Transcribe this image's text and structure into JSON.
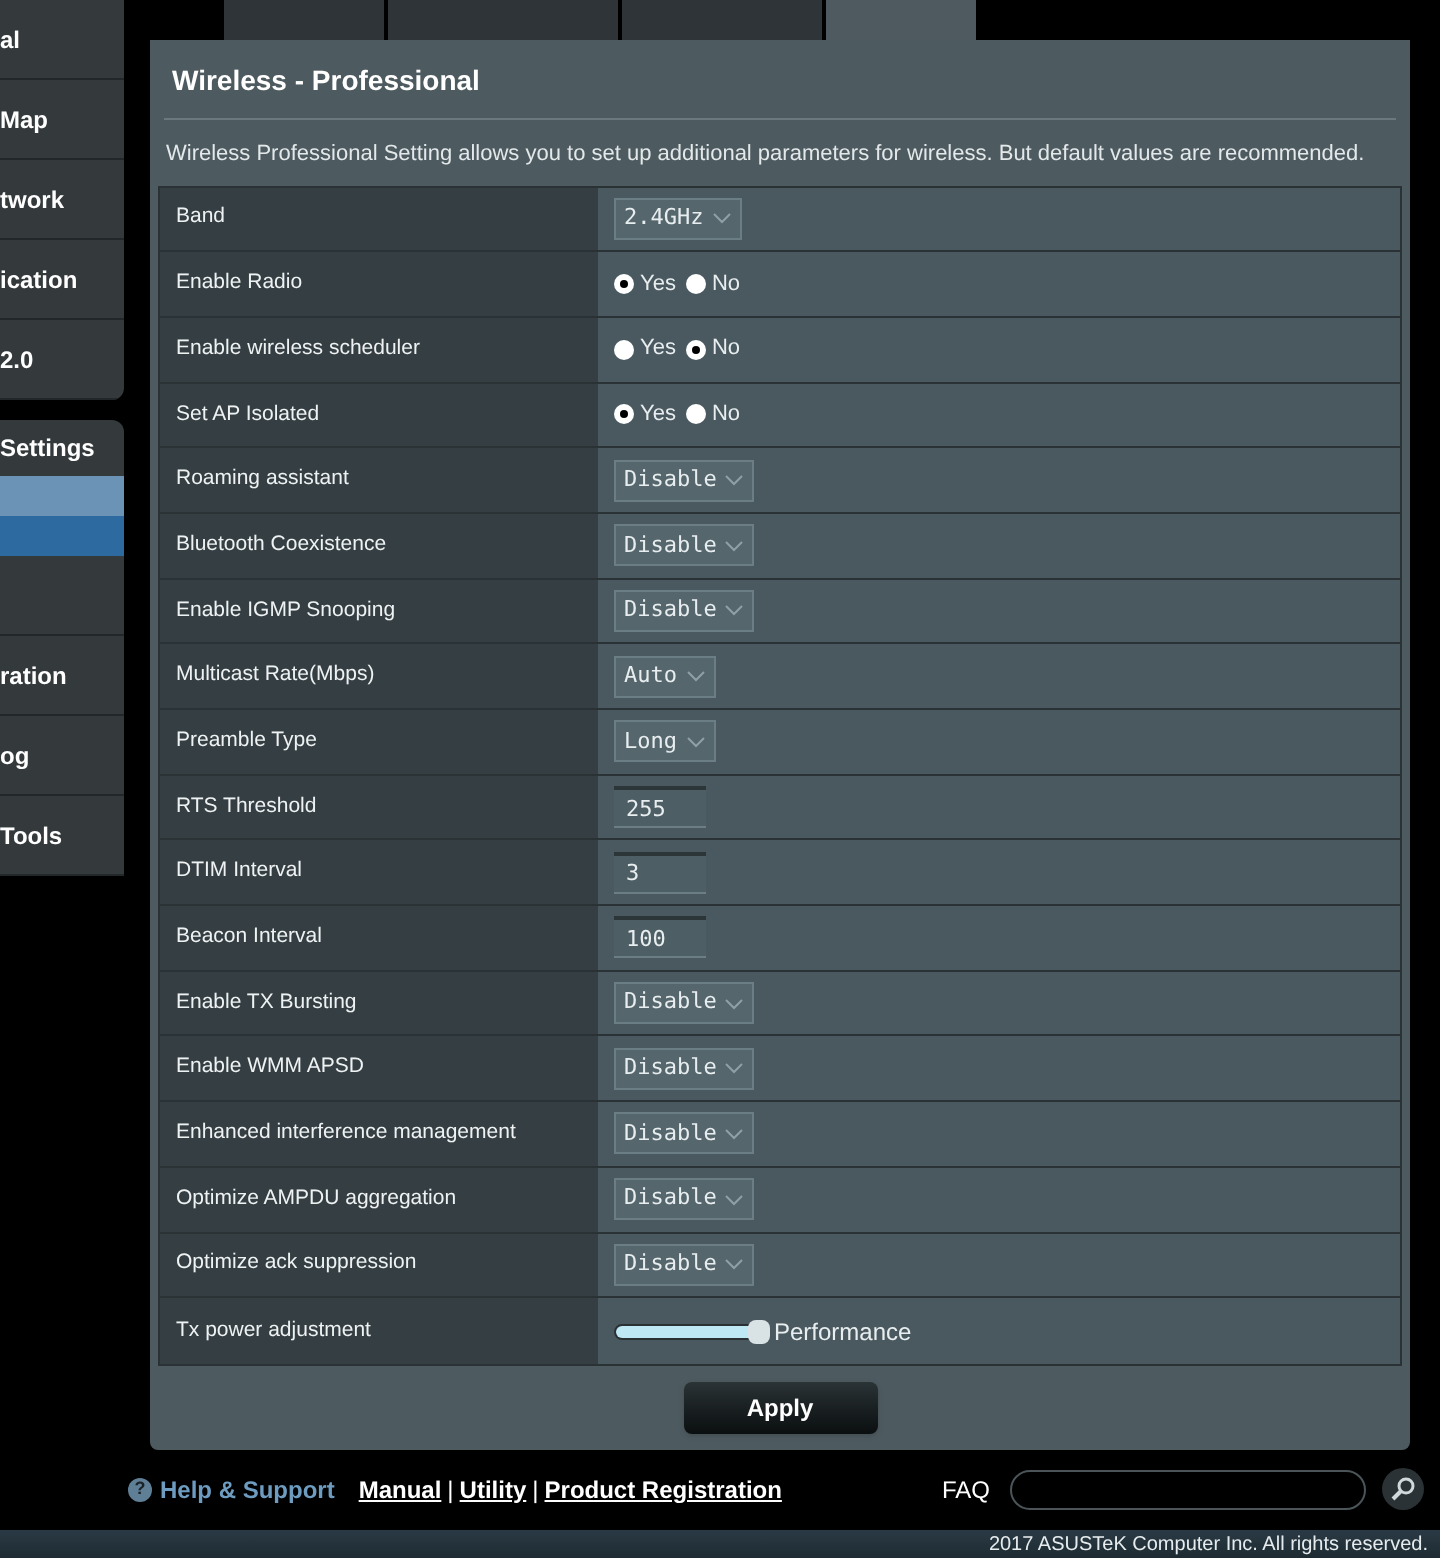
{
  "sidebar": {
    "items": [
      {
        "label": "al"
      },
      {
        "label": "Map"
      },
      {
        "label": "twork"
      },
      {
        "label": "ication"
      },
      {
        "label": "2.0"
      }
    ],
    "group": {
      "title": "Settings",
      "items": [
        {
          "selected": false,
          "hovered": true
        },
        {
          "selected": true,
          "hovered": false
        },
        {
          "selected": false,
          "hovered": false
        }
      ]
    },
    "items_after": [
      {
        "label": "ration"
      },
      {
        "label": "og"
      },
      {
        "label": "Tools"
      }
    ]
  },
  "page": {
    "title": "Wireless - Professional",
    "description": "Wireless Professional Setting allows you to set up additional parameters for wireless. But default values are recommended."
  },
  "settings": [
    {
      "label": "Band",
      "kind": "select",
      "value": "2.4GHz"
    },
    {
      "label": "Enable Radio",
      "kind": "radio",
      "options": [
        {
          "label": "Yes",
          "selected": true
        },
        {
          "label": "No",
          "selected": false
        }
      ]
    },
    {
      "label": "Enable wireless scheduler",
      "kind": "radio",
      "options": [
        {
          "label": "Yes",
          "selected": false
        },
        {
          "label": "No",
          "selected": true
        }
      ]
    },
    {
      "label": "Set AP Isolated",
      "kind": "radio",
      "options": [
        {
          "label": "Yes",
          "selected": true
        },
        {
          "label": "No",
          "selected": false
        }
      ]
    },
    {
      "label": "Roaming assistant",
      "kind": "select",
      "value": "Disable"
    },
    {
      "label": "Bluetooth Coexistence",
      "kind": "select",
      "value": "Disable"
    },
    {
      "label": "Enable IGMP Snooping",
      "kind": "select",
      "value": "Disable"
    },
    {
      "label": "Multicast Rate(Mbps)",
      "kind": "select",
      "value": "Auto"
    },
    {
      "label": "Preamble Type",
      "kind": "select",
      "value": "Long"
    },
    {
      "label": "RTS Threshold",
      "kind": "input",
      "value": "255"
    },
    {
      "label": "DTIM Interval",
      "kind": "input",
      "value": "3"
    },
    {
      "label": "Beacon Interval",
      "kind": "input",
      "value": "100"
    },
    {
      "label": "Enable TX Bursting",
      "kind": "select",
      "value": "Disable"
    },
    {
      "label": "Enable WMM APSD",
      "kind": "select",
      "value": "Disable"
    },
    {
      "label": "Enhanced interference management",
      "kind": "select",
      "value": "Disable"
    },
    {
      "label": "Optimize AMPDU aggregation",
      "kind": "select",
      "value": "Disable"
    },
    {
      "label": "Optimize ack suppression",
      "kind": "select",
      "value": "Disable"
    },
    {
      "label": "Tx power adjustment",
      "kind": "slider",
      "level": 1,
      "reading": "Performance"
    }
  ],
  "apply_button": "Apply",
  "footer": {
    "help_icon": "?",
    "help": "Help & Support",
    "separator": "|",
    "links": [
      "Manual",
      "Utility",
      "Product Registration"
    ],
    "faq": "FAQ"
  },
  "copyright": "2017 ASUSTeK Computer Inc. All rights reserved."
}
